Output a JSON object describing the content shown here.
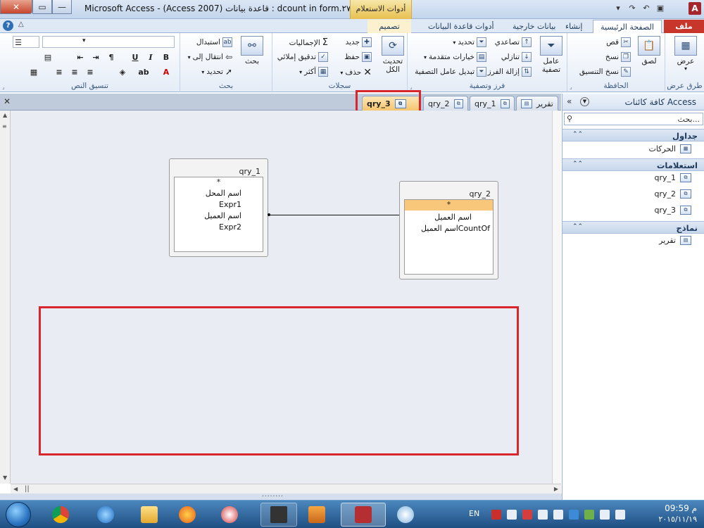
{
  "window": {
    "title": "Microsoft Access - (Access 2007) قاعدة بيانات : dcount in form.٢٧٤",
    "context_tab_group": "أدوات الاستعلام",
    "logo_letter": "A"
  },
  "ribbon_tabs": {
    "file": "ملف",
    "home": "الصفحة الرئيسية",
    "create": "إنشاء",
    "external": "بيانات خارجية",
    "dbtools": "أدوات قاعدة البيانات",
    "design": "تصميم"
  },
  "ribbon": {
    "views": {
      "view": "عرض",
      "label": "طرق عرض"
    },
    "clipboard": {
      "paste": "لصق",
      "cut": "قص",
      "copy": "نسخ",
      "format_painter": "نسخ التنسيق",
      "label": "الحافظة"
    },
    "sort_filter": {
      "filter": "عامل تصفية",
      "ascending": "تصاعدي",
      "descending": "تنازلي",
      "remove_sort": "إزالة الفرز",
      "selection": "تحديد",
      "advanced": "خيارات متقدمة",
      "toggle_filter": "تبديل عامل التصفية",
      "label": "فرز وتصفية"
    },
    "records": {
      "refresh": "تحديث الكل",
      "new": "جديد",
      "save": "حفظ",
      "delete": "حذف",
      "totals": "الإجماليات",
      "spelling": "تدقيق إملائي",
      "more": "أكثر",
      "label": "سجلات"
    },
    "find": {
      "find": "بحث",
      "replace": "استبدال",
      "goto": "انتقال إلى",
      "select": "تحديد",
      "label": "بحث"
    },
    "text_format": {
      "bold": "B",
      "italic": "I",
      "underline": "U",
      "font_color": "A",
      "label": "تنسيق النص"
    }
  },
  "nav_pane": {
    "title": "كافة كائنات Access",
    "search_placeholder": "بحث...",
    "sections": [
      {
        "label": "جداول",
        "items": [
          "الحركات"
        ]
      },
      {
        "label": "استعلامات",
        "items": [
          "qry_1",
          "qry_2",
          "qry_3"
        ]
      },
      {
        "label": "نماذج",
        "items": [
          "تقرير"
        ]
      }
    ]
  },
  "doc_tabs": [
    "تقرير",
    "qry_1",
    "qry_2",
    "qry_3"
  ],
  "active_doc_tab": "qry_3",
  "query_design": {
    "tables": [
      {
        "name": "qry_1",
        "star": "*",
        "fields": [
          "اسم المحل",
          "Expr1",
          "اسم العميل",
          "Expr2"
        ]
      },
      {
        "name": "qry_2",
        "star": "*",
        "fields": [
          "اسم العميل",
          "CountOfاسم العميل"
        ]
      }
    ]
  },
  "taskbar": {
    "language": "EN",
    "time": "09:59 م",
    "date": "٢٠١٥/١١/١٩"
  },
  "colors": {
    "highlight_red": "#d9262c",
    "file_tab": "#c8352a",
    "context_tab": "#e8c04f",
    "active_doc_tab": "#f6c56e"
  }
}
